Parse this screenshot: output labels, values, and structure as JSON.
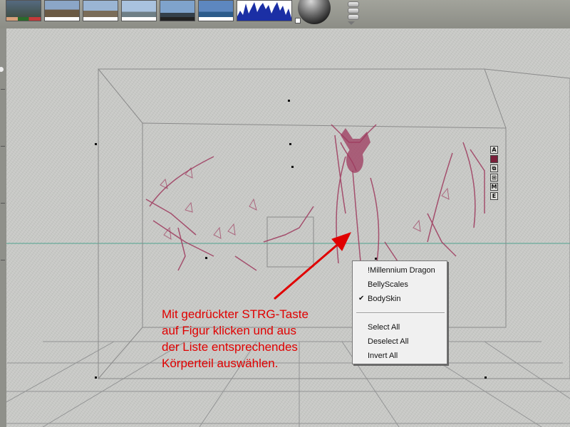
{
  "toolbar": {
    "thumbnails": [
      {
        "name": "preset-thumb-1",
        "sky": "#556a80",
        "ground": "#3b4a3a",
        "strip": [
          "#d6a07a",
          "#2a6b2a",
          "#c33a3a"
        ]
      },
      {
        "name": "preset-thumb-2",
        "sky": "#8ba6c7",
        "ground": "#6b5a44"
      },
      {
        "name": "preset-thumb-3",
        "sky": "#9ab5d4",
        "ground": "#7a6c58"
      },
      {
        "name": "preset-thumb-4",
        "sky": "#a9c2df",
        "ground": "#6e7f86"
      },
      {
        "name": "preset-thumb-5",
        "sky": "#7fa3cc",
        "ground": "#34404a"
      },
      {
        "name": "preset-thumb-6",
        "sky": "#5d87bf",
        "ground": "#2b5b8a"
      },
      {
        "name": "histogram-thumb",
        "sky": "#ffffff",
        "ground": "#1b2fa5"
      }
    ]
  },
  "side_icons": [
    "A",
    "■",
    "⧉",
    "⊞",
    "M",
    "E"
  ],
  "context_menu": {
    "items": [
      "!Millennium Dragon",
      "BellyScales",
      "BodySkin"
    ],
    "checked_index": 2,
    "check_mark": "✔",
    "actions": [
      "Select All",
      "Deselect All",
      "Invert All"
    ]
  },
  "annotation": {
    "lines": [
      "Mit gedrückter STRG-Taste",
      "auf Figur klicken und aus",
      "der Liste entsprechendes",
      "Körperteil auswählen."
    ],
    "color": "#e00000"
  },
  "colors": {
    "figure": "#9e3a5e",
    "horizon": "#4fa28e",
    "grid": "#8e8f90",
    "arrow": "#e00000"
  }
}
